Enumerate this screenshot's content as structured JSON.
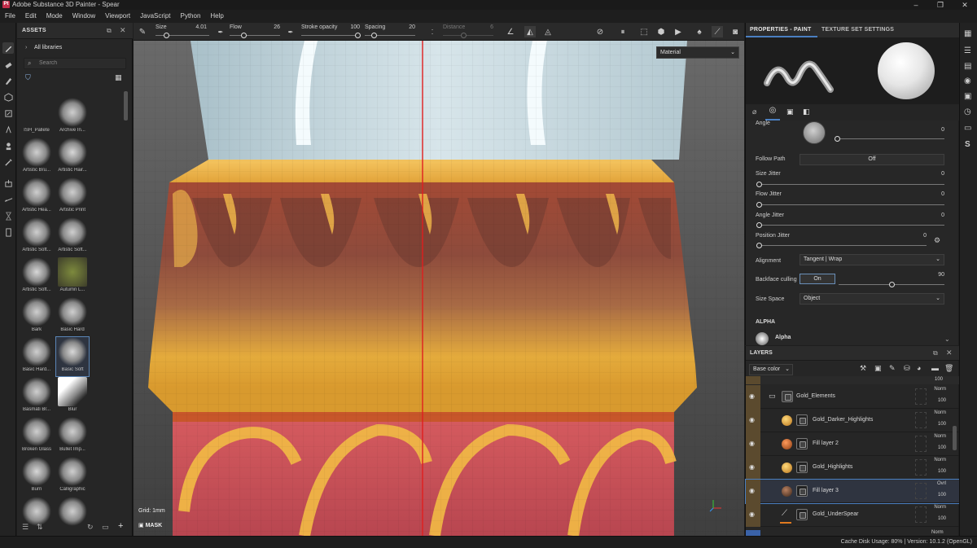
{
  "window": {
    "title": "Adobe Substance 3D Painter - Spear",
    "logo": "Pt",
    "controls": [
      "–",
      "❐",
      "✕"
    ]
  },
  "menu": [
    "File",
    "Edit",
    "Mode",
    "Window",
    "Viewport",
    "JavaScript",
    "Python",
    "Help"
  ],
  "toolbar": {
    "size_label": "Size",
    "size_value": "4.01",
    "flow_label": "Flow",
    "flow_value": "26",
    "stroke_label": "Stroke opacity",
    "stroke_value": "100",
    "spacing_label": "Spacing",
    "spacing_value": "20",
    "distance_label": "Distance",
    "distance_value": "6"
  },
  "assets": {
    "title": "ASSETS",
    "all_libraries": "All libraries",
    "search_placeholder": "Search",
    "items": [
      {
        "label": "ISH_Pallete"
      },
      {
        "label": "Archive In..."
      },
      {
        "label": "Artistic Bru..."
      },
      {
        "label": "Artistic Hair..."
      },
      {
        "label": "Artistic Hea..."
      },
      {
        "label": "Artistic Print"
      },
      {
        "label": "Artistic Soft..."
      },
      {
        "label": "Artistic Soft..."
      },
      {
        "label": "Artistic Soft..."
      },
      {
        "label": "Autumn L..."
      },
      {
        "label": "Bark"
      },
      {
        "label": "Basic Hard"
      },
      {
        "label": "Basic Hard..."
      },
      {
        "label": "Basic Soft"
      },
      {
        "label": "Basmati Br..."
      },
      {
        "label": "Blur"
      },
      {
        "label": "Broken Glass"
      },
      {
        "label": "Bullet Imp..."
      },
      {
        "label": "Burn"
      },
      {
        "label": "Calligraphic"
      },
      {
        "label": ""
      },
      {
        "label": ""
      }
    ],
    "selected": "Basic Soft"
  },
  "viewport": {
    "material_mode": "Material",
    "grid_label": "Grid: 1mm",
    "mask_label": "MASK"
  },
  "properties": {
    "tab_paint": "PROPERTIES - PAINT",
    "tab_texture": "TEXTURE SET SETTINGS",
    "angle_label": "Angle",
    "angle_value": "0",
    "follow_path_label": "Follow Path",
    "follow_path_value": "Off",
    "size_jitter_label": "Size Jitter",
    "size_jitter_value": "0",
    "flow_jitter_label": "Flow Jitter",
    "flow_jitter_value": "0",
    "angle_jitter_label": "Angle Jitter",
    "angle_jitter_value": "0",
    "position_jitter_label": "Position Jitter",
    "position_jitter_value": "0",
    "alignment_label": "Alignment",
    "alignment_value": "Tangent | Wrap",
    "backface_label": "Backface culling",
    "backface_button": "On",
    "backface_value": "90",
    "size_space_label": "Size Space",
    "size_space_value": "Object",
    "alpha_section": "ALPHA",
    "alpha_item": "Alpha"
  },
  "layers": {
    "title": "LAYERS",
    "channel": "Base color",
    "top_opacity": "100",
    "rows": [
      {
        "name": "Gold_Elements",
        "blend": "Norm",
        "opacity": "100",
        "type": "folder"
      },
      {
        "name": "Gold_Darker_Highlights",
        "blend": "Norm",
        "opacity": "100",
        "type": "gold"
      },
      {
        "name": "Fill layer 2",
        "blend": "Norm",
        "opacity": "100",
        "type": "orange"
      },
      {
        "name": "Gold_Highlights",
        "blend": "Norm",
        "opacity": "100",
        "type": "gold"
      },
      {
        "name": "Fill layer 3",
        "blend": "Ovrl",
        "opacity": "100",
        "type": "dark"
      },
      {
        "name": "Gold_UnderSpear",
        "blend": "Norm",
        "opacity": "100",
        "type": "brush"
      }
    ],
    "last_blend": "Norm"
  },
  "status": {
    "text": "Cache Disk Usage:    80% | Version: 10.1.2 (OpenGL)"
  },
  "colors": {
    "accent": "#4a7fc1",
    "gold": "#e8a93a",
    "red": "#c8505a",
    "glass": "#c9dbe3"
  }
}
